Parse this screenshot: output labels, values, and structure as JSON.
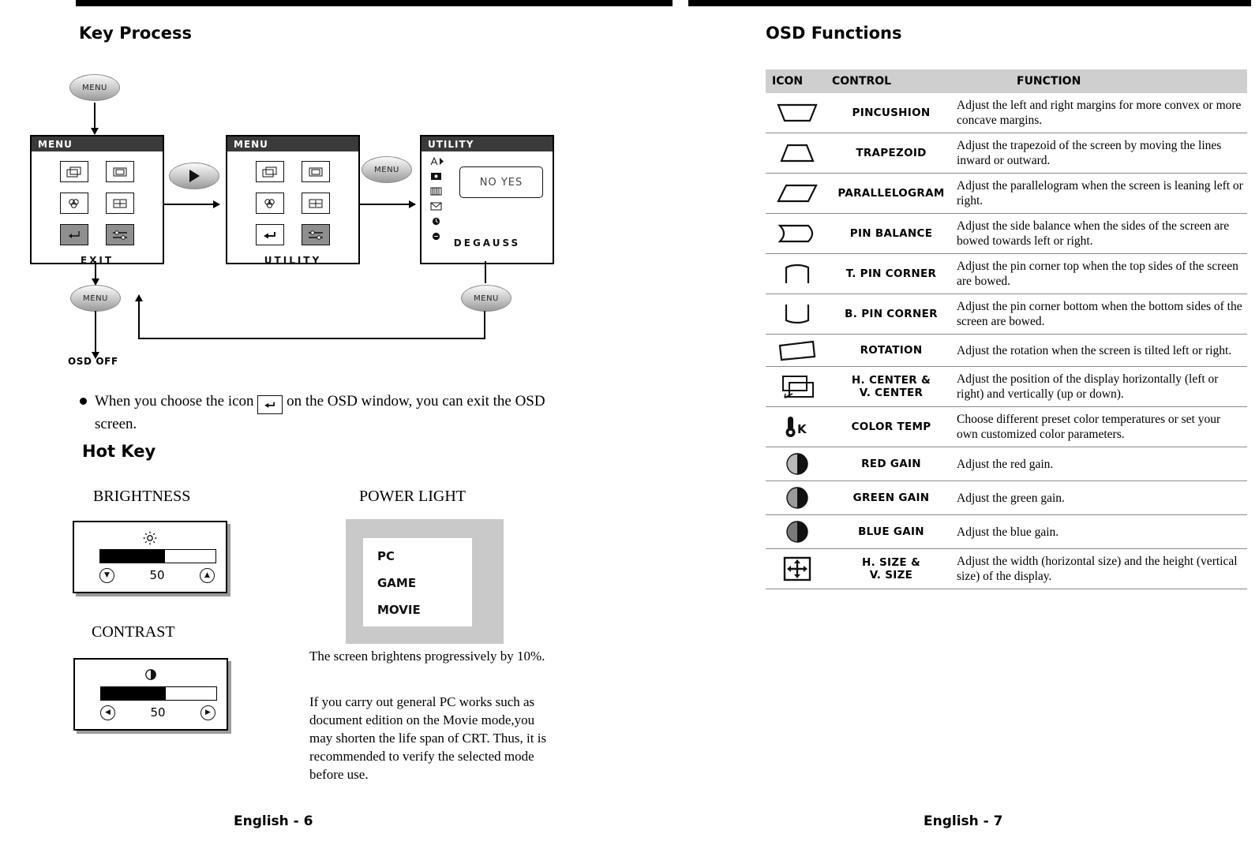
{
  "left_page": {
    "title": "Key Process",
    "hot_key_title": "Hot Key",
    "page_label": "English - 6",
    "diagram": {
      "menu_button_top": "MENU",
      "menu_button_left": "MENU",
      "menu_button_mid": "MENU",
      "menu_button_right": "MENU",
      "osd_off_label": "OSD OFF",
      "box1_title": "MENU",
      "box1_footer": "EXIT",
      "box2_title": "MENU",
      "box2_footer": "UTILITY",
      "box3_title": "UTILITY",
      "box3_footer": "DEGAUSS",
      "degauss_prompt": "NO  YES"
    },
    "note": {
      "text_before": "When you choose the icon",
      "text_after": "on the OSD window, you can exit the OSD screen."
    },
    "brightness": {
      "label": "BRIGHTNESS",
      "value": "50",
      "icon": "brightness-sun-icon"
    },
    "contrast": {
      "label": "CONTRAST",
      "value": "50",
      "icon": "contrast-half-circle-icon"
    },
    "power_light": {
      "label": "POWER LIGHT",
      "options": [
        "PC",
        "GAME",
        "MOVIE"
      ],
      "para1": "The screen brightens progressively by 10%.",
      "para2": "If you carry out general PC works such as document edition on the Movie mode,you may shorten the life span of CRT. Thus, it is recommended to verify the selected mode before use."
    }
  },
  "right_page": {
    "title": "OSD Functions",
    "page_label": "English - 7",
    "table": {
      "headers": [
        "ICON",
        "CONTROL",
        "FUNCTION"
      ],
      "rows": [
        {
          "icon": "pincushion-icon",
          "control": "PINCUSHION",
          "control2": "",
          "function": "Adjust the left and right margins for more convex or more concave margins."
        },
        {
          "icon": "trapezoid-icon",
          "control": "TRAPEZOID",
          "control2": "",
          "function": "Adjust the trapezoid of the screen by moving the lines inward or outward."
        },
        {
          "icon": "parallelogram-icon",
          "control": "PARALLELOGRAM",
          "control2": "",
          "function": "Adjust the parallelogram when the screen is leaning left or right."
        },
        {
          "icon": "pin-balance-icon",
          "control": "PIN BALANCE",
          "control2": "",
          "function": "Adjust the side balance when the sides of the screen are bowed towards left or right."
        },
        {
          "icon": "top-pin-corner-icon",
          "control": "T. PIN CORNER",
          "control2": "",
          "function": "Adjust the pin corner top when the top sides of the screen are bowed."
        },
        {
          "icon": "bottom-pin-corner-icon",
          "control": "B. PIN CORNER",
          "control2": "",
          "function": "Adjust the pin corner bottom when the bottom sides of the screen are bowed."
        },
        {
          "icon": "rotation-icon",
          "control": "ROTATION",
          "control2": "",
          "function": "Adjust the rotation when the screen is tilted left or right."
        },
        {
          "icon": "center-position-icon",
          "control": "H. CENTER &",
          "control2": "V. CENTER",
          "function": "Adjust the position of the display horizontally (left or right) and vertically (up or down)."
        },
        {
          "icon": "color-temp-icon",
          "control": "COLOR TEMP",
          "control2": "",
          "function": "Choose different preset color temperatures or set your own customized color parameters."
        },
        {
          "icon": "red-gain-icon",
          "control": "RED GAIN",
          "control2": "",
          "function": "Adjust the red gain."
        },
        {
          "icon": "green-gain-icon",
          "control": "GREEN GAIN",
          "control2": "",
          "function": "Adjust the green gain."
        },
        {
          "icon": "blue-gain-icon",
          "control": "BLUE GAIN",
          "control2": "",
          "function": "Adjust the blue gain."
        },
        {
          "icon": "size-icon",
          "control": "H. SIZE &",
          "control2": "V. SIZE",
          "function": "Adjust the width (horizontal size) and the height (vertical size) of the display."
        }
      ]
    }
  }
}
